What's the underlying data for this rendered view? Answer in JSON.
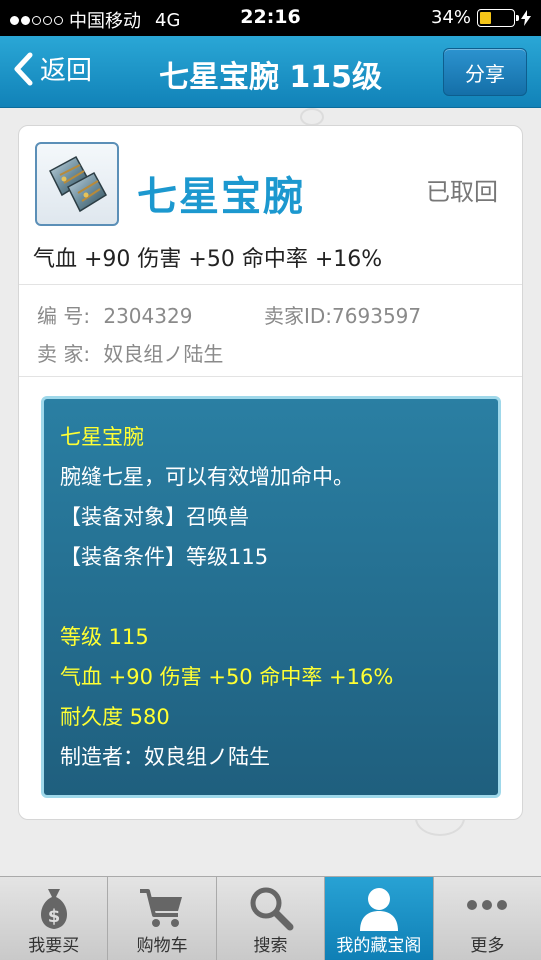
{
  "status_bar": {
    "carrier": "中国移动",
    "network": "4G",
    "time": "22:16",
    "battery_percent": "34%",
    "battery_level": 0.34,
    "signal_bars": 2
  },
  "nav": {
    "back_label": "返回",
    "title": "七星宝腕 115级",
    "share_label": "分享"
  },
  "item": {
    "name": "七星宝腕",
    "status": "已取回",
    "attributes": "气血 +90 伤害 +50 命中率 +16%",
    "icon": "wrist-guard-icon",
    "id_label": "编  号:",
    "id_value": "2304329",
    "seller_id_label": "卖家ID:",
    "seller_id_value": "7693597",
    "seller_label": "卖  家:",
    "seller_value": "奴良组ノ陆生"
  },
  "tooltip": {
    "title": "七星宝腕",
    "description": "腕缝七星，可以有效增加命中。",
    "equip_target": "【装备对象】召唤兽",
    "equip_condition": "【装备条件】等级115",
    "level": "等级 115",
    "stats": "气血 +90 伤害 +50 命中率 +16%",
    "durability": "耐久度 580",
    "maker": "制造者：奴良组ノ陆生"
  },
  "tabs": [
    {
      "label": "我要买",
      "icon": "money-bag-icon",
      "active": false
    },
    {
      "label": "购物车",
      "icon": "cart-icon",
      "active": false
    },
    {
      "label": "搜索",
      "icon": "search-icon",
      "active": false
    },
    {
      "label": "我的藏宝阁",
      "icon": "user-icon",
      "active": true
    },
    {
      "label": "更多",
      "icon": "more-icon",
      "active": false
    }
  ],
  "colors": {
    "accent": "#1c98cf",
    "nav_bg": "#1a94c8",
    "tooltip_bg": "#246e91",
    "highlight_yellow": "#ffff33"
  }
}
